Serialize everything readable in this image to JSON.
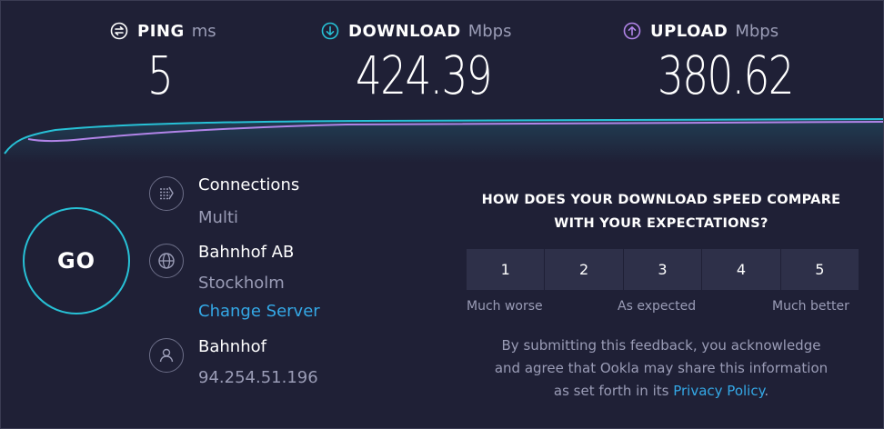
{
  "results": {
    "ping": {
      "label": "PING",
      "unit": "ms",
      "value": "5",
      "icon": "ping-icon"
    },
    "download": {
      "label": "DOWNLOAD",
      "unit": "Mbps",
      "value": "424.39",
      "icon": "download-arrow-icon",
      "color": "#27c1d6"
    },
    "upload": {
      "label": "UPLOAD",
      "unit": "Mbps",
      "value": "380.62",
      "icon": "upload-arrow-icon",
      "color": "#b184e8"
    }
  },
  "go_label": "GO",
  "connections": {
    "title": "Connections",
    "value": "Multi",
    "icon": "connections-icon"
  },
  "server": {
    "name": "Bahnhof AB",
    "location": "Stockholm",
    "change_label": "Change Server",
    "icon": "globe-icon"
  },
  "provider": {
    "name": "Bahnhof",
    "ip": "94.254.51.196",
    "icon": "user-icon"
  },
  "feedback": {
    "question_line1": "HOW DOES YOUR DOWNLOAD SPEED COMPARE",
    "question_line2": "WITH YOUR EXPECTATIONS?",
    "options": [
      "1",
      "2",
      "3",
      "4",
      "5"
    ],
    "label_low": "Much worse",
    "label_mid": "As expected",
    "label_high": "Much better",
    "note_line1": "By submitting this feedback, you acknowledge",
    "note_line2": "and agree that Ookla may share this information",
    "note_line3_prefix": "as set forth in its",
    "privacy_link": "Privacy Policy",
    "note_line3_suffix": "."
  },
  "colors": {
    "background": "#1f2036",
    "accent_cyan": "#27c1d6",
    "accent_purple": "#b184e8",
    "link": "#34a8e6"
  }
}
